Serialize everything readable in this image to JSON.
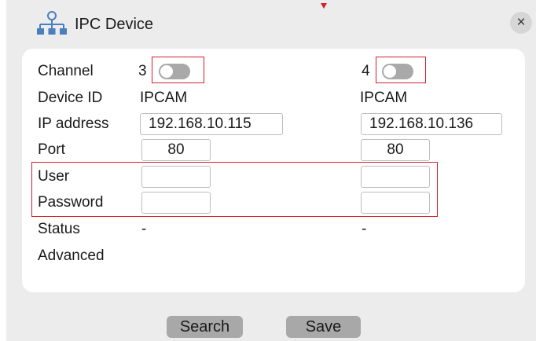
{
  "dialog": {
    "title": "IPC Device",
    "close_label": "×"
  },
  "labels": {
    "channel": "Channel",
    "device_id": "Device ID",
    "ip_address": "IP address",
    "port": "Port",
    "user": "User",
    "password": "Password",
    "status": "Status",
    "advanced": "Advanced"
  },
  "columns": [
    {
      "channel": "3",
      "enabled": false,
      "device_id": "IPCAM",
      "ip_address": "192.168.10.115",
      "port": "80",
      "user": "",
      "password": "",
      "status": "-"
    },
    {
      "channel": "4",
      "enabled": false,
      "device_id": "IPCAM",
      "ip_address": "192.168.10.136",
      "port": "80",
      "user": "",
      "password": "",
      "status": "-"
    }
  ],
  "buttons": {
    "search": "Search",
    "save": "Save"
  },
  "colors": {
    "highlight": "#d21f2e",
    "icon": "#4a7fbf",
    "toggle_off": "#a9a9a9",
    "button": "#a8a8a8"
  }
}
